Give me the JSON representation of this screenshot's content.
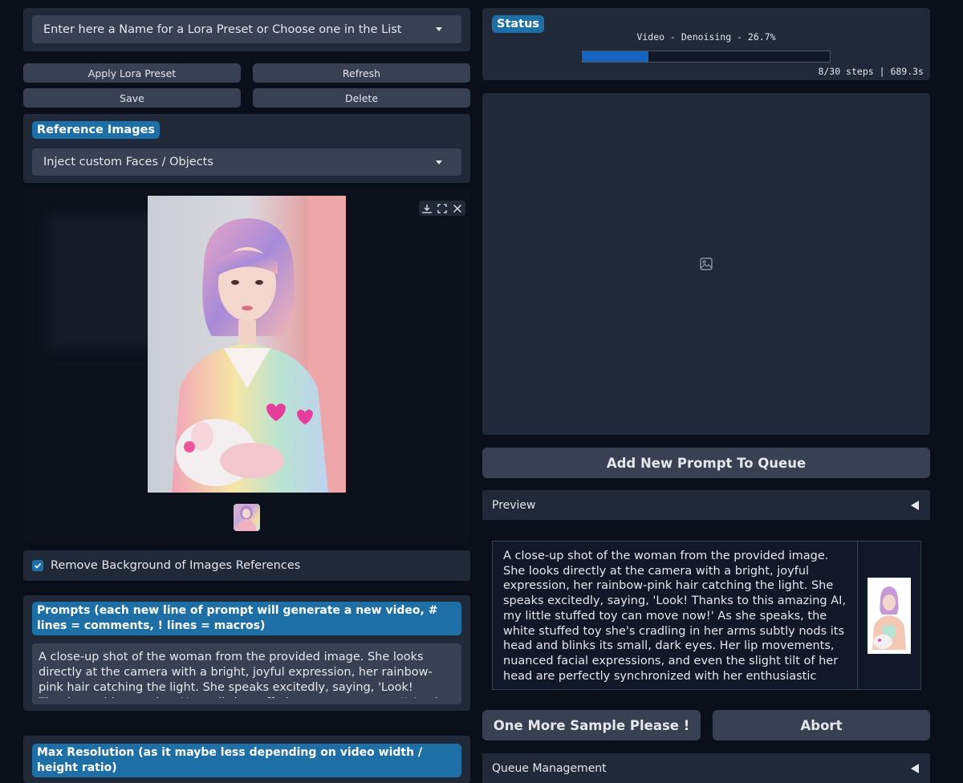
{
  "lora": {
    "preset_placeholder": "Enter here a Name for a Lora Preset or Choose one in the List",
    "apply_label": "Apply Lora Preset",
    "refresh_label": "Refresh",
    "save_label": "Save",
    "delete_label": "Delete"
  },
  "reference": {
    "title": "Reference Images",
    "mode_value": "Inject custom Faces / Objects",
    "remove_bg_label": "Remove Background of Images References",
    "remove_bg_checked": true,
    "gallery_icons": [
      "download-icon",
      "fullscreen-icon",
      "close-icon"
    ]
  },
  "prompts": {
    "title": "Prompts (each new line of prompt will generate a new video, # lines = comments, ! lines = macros)",
    "text": "A close-up shot of the woman from the provided image. She looks directly at the camera with a bright, joyful expression, her rainbow-pink hair catching the light. She speaks excitedly, saying, 'Look! Thanks to this amazing AI, my little stuffed toy can move now!' As she speaks, the white stuffed toy she's"
  },
  "max_resolution": {
    "title": "Max Resolution (as it maybe less depending on video width / height ratio)"
  },
  "status": {
    "title": "Status",
    "progress_text": "Video - Denoising - 26.7%",
    "progress_value": 0.267,
    "steps_text": "8/30 steps | 689.3s"
  },
  "output": {
    "placeholder_icon": "image-icon"
  },
  "queue": {
    "add_label": "Add New Prompt To Queue",
    "preview_label": "Preview",
    "queued_prompt": "A close-up shot of the woman from the provided image. She looks directly at the camera with a bright, joyful expression, her rainbow-pink hair catching the light. She speaks excitedly, saying, 'Look! Thanks to this amazing AI, my little stuffed toy can move now!' As she speaks, the white stuffed toy she's cradling in her arms subtly nods its head and blinks its small, dark eyes. Her lip movements, nuanced facial expressions, and even the slight tilt of her head are perfectly synchronized with her enthusiastic voice. The lighting is warm and inviting",
    "one_more_label": "One More Sample Please !",
    "abort_label": "Abort",
    "management_label": "Queue Management"
  },
  "colors": {
    "accent": "#1d6fa5",
    "progress_fill": "#1565c0",
    "panel": "#1f2937",
    "control": "#374151"
  }
}
